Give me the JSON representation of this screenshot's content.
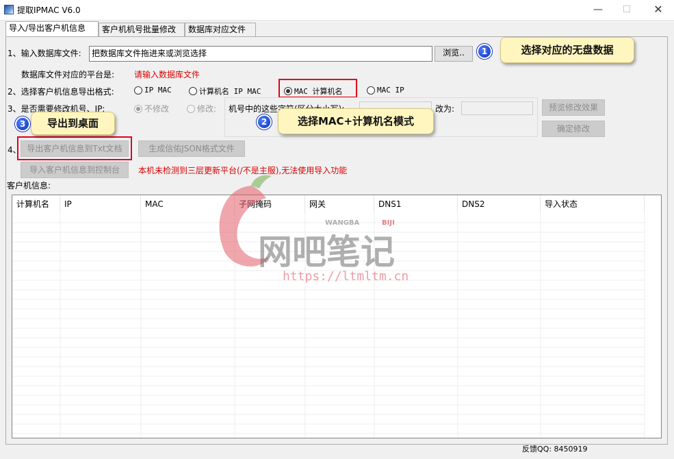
{
  "window": {
    "title": "提取IPMAC V6.0",
    "minimize": "—",
    "maximize": "☐",
    "close": "✕"
  },
  "tabs": [
    {
      "label": "导入/导出客户机信息",
      "active": true
    },
    {
      "label": "客户机机号批量修改",
      "active": false
    },
    {
      "label": "数据库对应文件",
      "active": false
    }
  ],
  "step1": {
    "label": "1、输入数据库文件:",
    "input_value": "把数据库文件拖进来或浏览选择",
    "browse_button": "浏览..",
    "platform_label": "数据库文件对应的平台是:",
    "platform_value": "请输入数据库文件"
  },
  "step2": {
    "label": "2、选择客户机信息导出格式:",
    "options": [
      {
        "label": "IP MAC",
        "checked": false
      },
      {
        "label": "计算机名 IP MAC",
        "checked": false
      },
      {
        "label": "MAC 计算机名",
        "checked": true
      },
      {
        "label": "MAC IP",
        "checked": false
      }
    ]
  },
  "step3": {
    "label": "3、是否需要修改机号、IP:",
    "options": [
      {
        "label": "不修改",
        "checked": true
      },
      {
        "label": "修改:",
        "checked": false
      }
    ],
    "pattern_label": "机号中的这些字符(区分大小写):",
    "change_to_label": "改为:",
    "preview_button": "预览修改效果",
    "confirm_button": "确定修改"
  },
  "step4": {
    "label": "4、",
    "export_txt_button": "导出客户机信息到Txt文档",
    "json_button": "生成信佑JSON格式文件",
    "import_console_button": "导入客户机信息到控制台",
    "warning": "本机未检测到三层更新平台(/不是主服),无法使用导入功能"
  },
  "client_info_label": "客户机信息:",
  "table": {
    "columns": [
      "计算机名",
      "IP",
      "MAC",
      "子网掩码",
      "网关",
      "DNS1",
      "DNS2",
      "导入状态"
    ],
    "rows": []
  },
  "callouts": [
    {
      "number": "1",
      "text": "选择对应的无盘数据"
    },
    {
      "number": "2",
      "text": "选择MAC+计算机名模式"
    },
    {
      "number": "3",
      "text": "导出到桌面"
    }
  ],
  "watermark": {
    "logo_text": "网吧笔记",
    "small_text_1": "WANGBA",
    "small_text_2": "BIJI",
    "url": "https://ltmltm.cn"
  },
  "status": {
    "feedback": "反馈QQ: 8450919"
  },
  "colors": {
    "accent_red": "#d90000",
    "callout_bg": "#fff6bf",
    "badge_blue": "#0b2fb8",
    "highlight_red": "#e0001a"
  },
  "icons": {
    "app": "app-icon",
    "minimize": "minimize-icon",
    "maximize": "maximize-icon",
    "close": "close-icon"
  }
}
